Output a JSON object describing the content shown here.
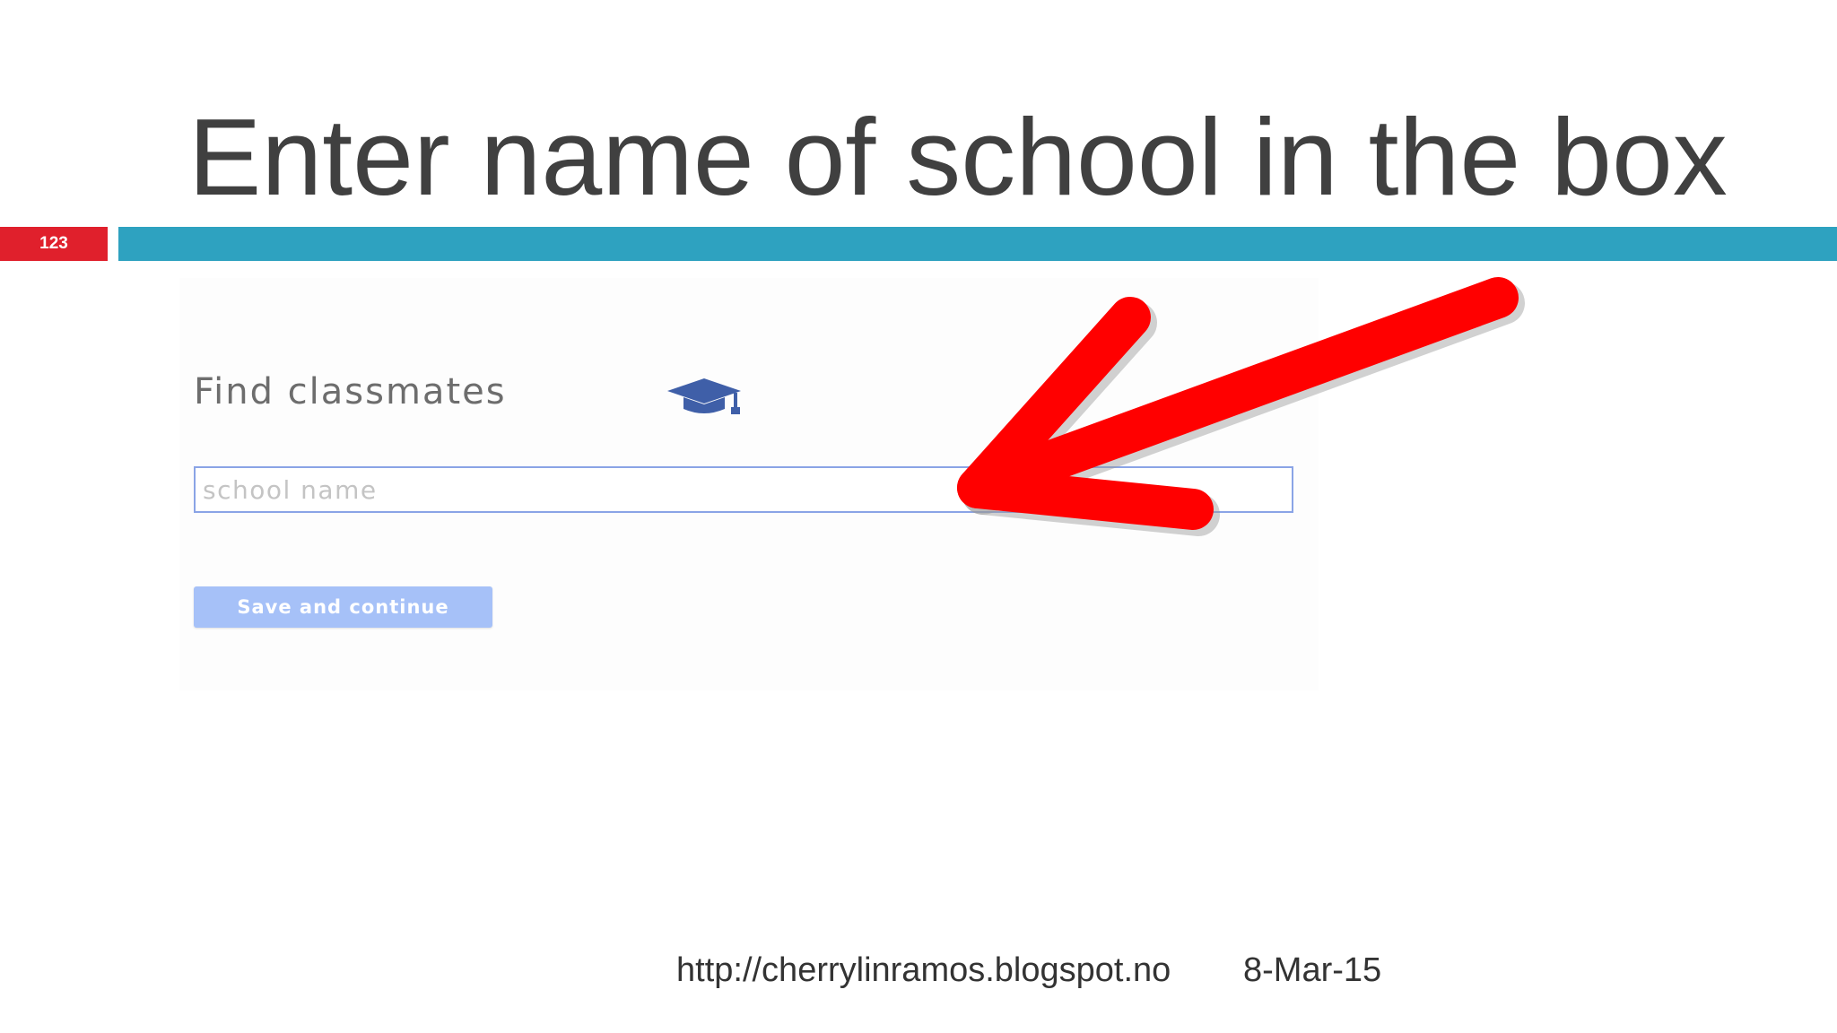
{
  "slide": {
    "title": "Enter name of school in the box",
    "number": "123"
  },
  "form": {
    "heading": "Find classmates",
    "heading_icon": "graduation-cap-icon",
    "school_input": {
      "placeholder": "school name",
      "value": ""
    },
    "save_button_label": "Save and continue"
  },
  "annotation": {
    "arrow_icon": "red-arrow-icon"
  },
  "footer": {
    "url": "http://cherrylinramos.blogspot.no",
    "date": "8-Mar-15"
  },
  "colors": {
    "title_text": "#404040",
    "slide_number_bg": "#e0202c",
    "accent_bar": "#2ea2c0",
    "arrow": "#ff0000",
    "cap_icon": "#3f5fa8",
    "input_border": "#8aa4e6",
    "button_bg": "#a6c1f8"
  }
}
